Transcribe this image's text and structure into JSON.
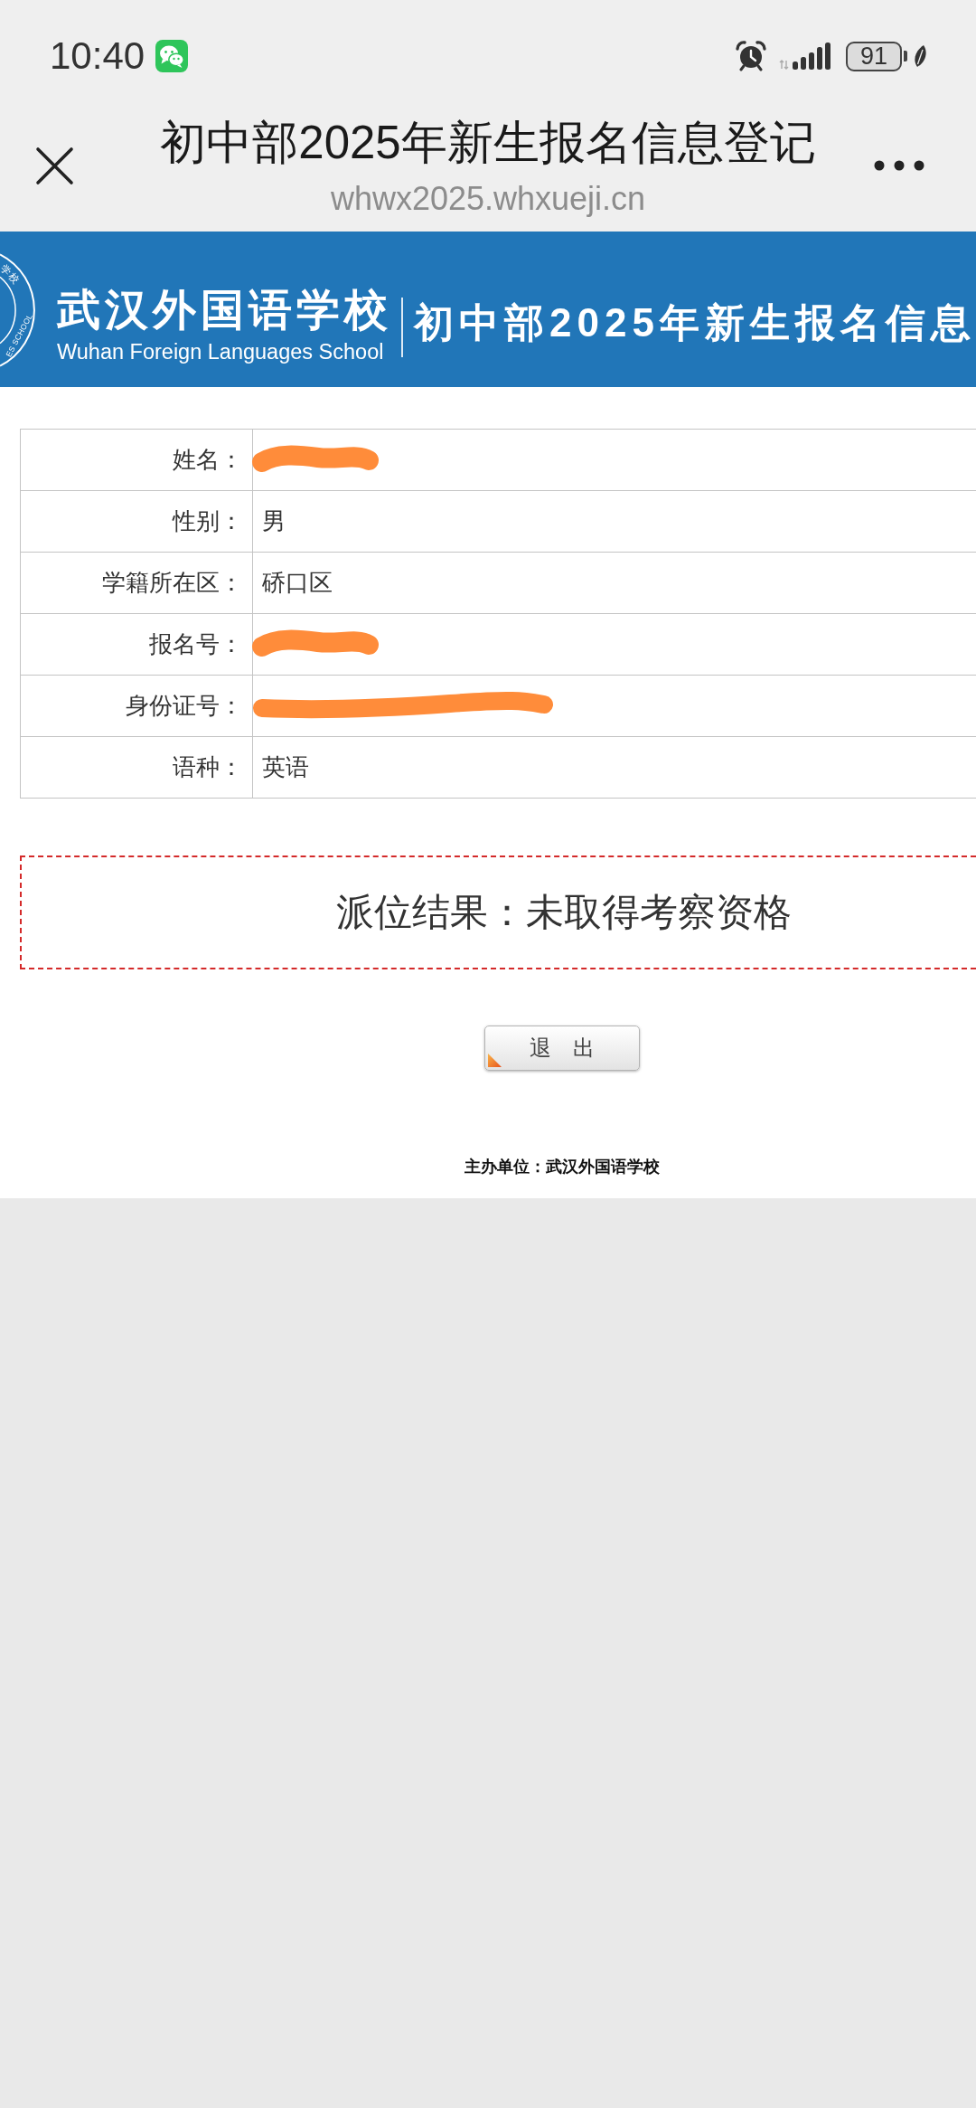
{
  "status_bar": {
    "time": "10:40",
    "battery": "91"
  },
  "title_bar": {
    "title": "初中部2025年新生报名信息登记",
    "url": "whwx2025.whxueji.cn"
  },
  "banner": {
    "emblem_texts": [
      "学校",
      "ES SCHOOL"
    ],
    "school_name": "武汉外国语学校",
    "school_name_en": "Wuhan Foreign Languages School",
    "heading": "初中部2025年新生报名信息"
  },
  "info_table": {
    "rows": [
      {
        "label": "姓名：",
        "kind": "scribble"
      },
      {
        "label": "性别：",
        "kind": "text",
        "value": "男"
      },
      {
        "label": "学籍所在区：",
        "kind": "text",
        "value": "硚口区"
      },
      {
        "label": "报名号：",
        "kind": "scribble"
      },
      {
        "label": "身份证号：",
        "kind": "longscribble"
      },
      {
        "label": "语种：",
        "kind": "text",
        "value": "英语"
      }
    ]
  },
  "result": {
    "text": "派位结果：未取得考察资格"
  },
  "exit_button": {
    "label": "退　出"
  },
  "footer": {
    "text": "主办单位：武汉外国语学校"
  }
}
